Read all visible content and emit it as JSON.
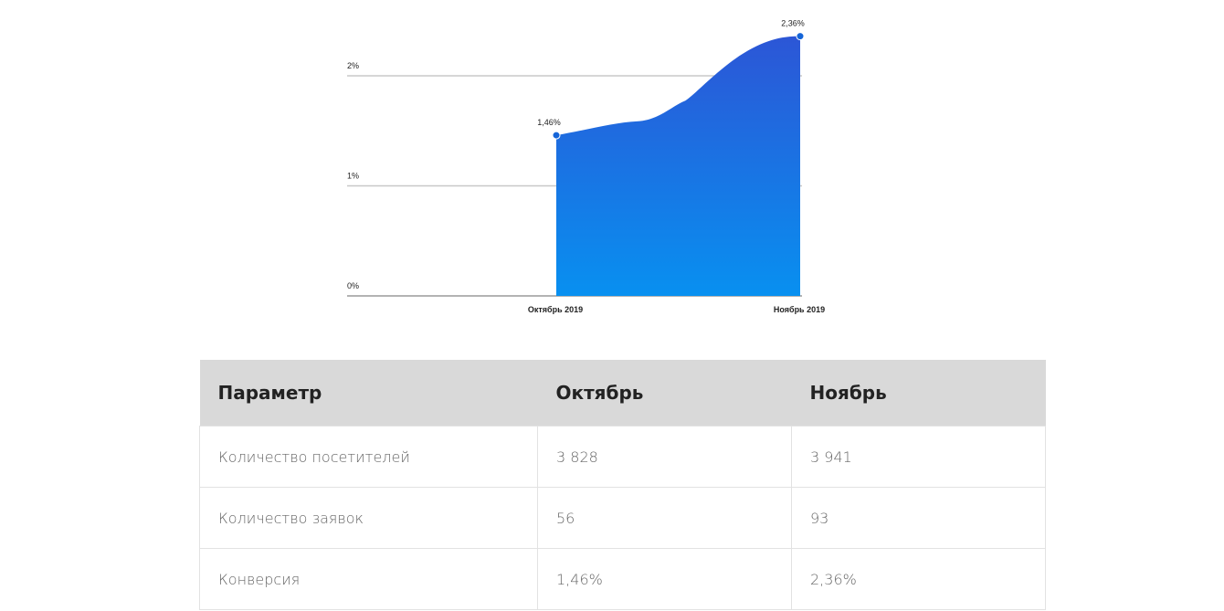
{
  "chart_data": {
    "type": "area",
    "categories": [
      "Октябрь 2019",
      "Ноябрь 2019"
    ],
    "values": [
      1.46,
      2.36
    ],
    "data_labels": [
      "1,46%",
      "2,36%"
    ],
    "y_ticks": [
      {
        "value": 0,
        "label": "0%"
      },
      {
        "value": 1,
        "label": "1%"
      },
      {
        "value": 2,
        "label": "2%"
      }
    ],
    "ylim": [
      0,
      2.4
    ],
    "grid": true,
    "colors": {
      "top": "#2c56d6",
      "bottom": "#0890f0",
      "marker": "#1565d8"
    }
  },
  "table": {
    "headers": [
      "Параметр",
      "Октябрь",
      "Ноябрь"
    ],
    "rows": [
      [
        "Количество посетителей",
        "3 828",
        "3 941"
      ],
      [
        "Количество заявок",
        "56",
        "93"
      ],
      [
        "Конверсия",
        "1,46%",
        "2,36%"
      ]
    ]
  }
}
